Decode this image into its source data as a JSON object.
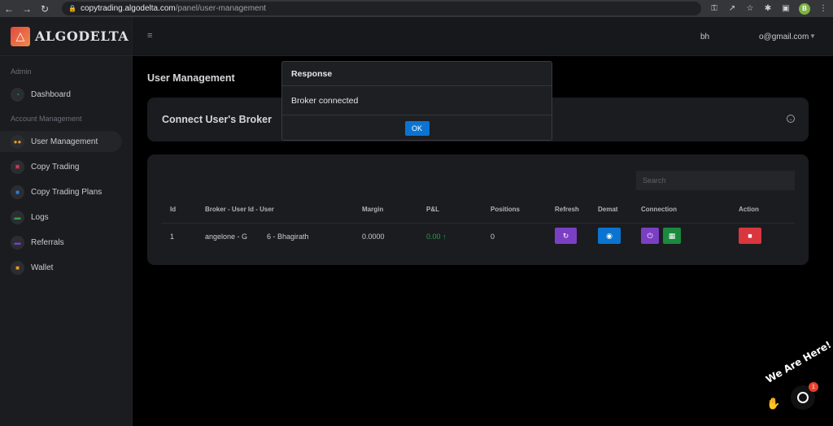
{
  "browser": {
    "url_host": "copytrading.algodelta.com",
    "url_path": "/panel/user-management",
    "profile_initial": "B"
  },
  "brand": {
    "name": "ALGODELTA"
  },
  "sidebar": {
    "admin_label": "Admin",
    "account_label": "Account Management",
    "items": [
      {
        "label": "Dashboard",
        "icon": "gauge-icon",
        "color": "#2ea44f"
      },
      {
        "label": "User Management",
        "icon": "users-icon",
        "color": "#e39b2b"
      },
      {
        "label": "Copy Trading",
        "icon": "copy-icon",
        "color": "#d83a5b"
      },
      {
        "label": "Copy Trading Plans",
        "icon": "plans-icon",
        "color": "#2f7de1"
      },
      {
        "label": "Logs",
        "icon": "logs-icon",
        "color": "#2ea44f"
      },
      {
        "label": "Referrals",
        "icon": "referral-icon",
        "color": "#7b3fc4"
      },
      {
        "label": "Wallet",
        "icon": "wallet-icon",
        "color": "#e39b2b"
      }
    ]
  },
  "topbar": {
    "user_short": "bh",
    "user_email": "o@gmail.com"
  },
  "page": {
    "title": "User Management"
  },
  "connect_card": {
    "title": "Connect User's Broker"
  },
  "table": {
    "search_placeholder": "Search",
    "headers": [
      "Id",
      "Broker - User Id - User",
      "Margin",
      "P&L",
      "Positions",
      "Refresh",
      "Demat",
      "Connection",
      "Action"
    ],
    "rows": [
      {
        "id": "1",
        "broker": "angelone - G",
        "user": "6 - Bhagirath",
        "margin": "0.0000",
        "pl": "0.00 ↑",
        "positions": "0"
      }
    ]
  },
  "modal": {
    "title": "Response",
    "message": "Broker connected",
    "ok_label": "OK"
  },
  "chat": {
    "text": "We Are Here!",
    "badge": "1"
  }
}
